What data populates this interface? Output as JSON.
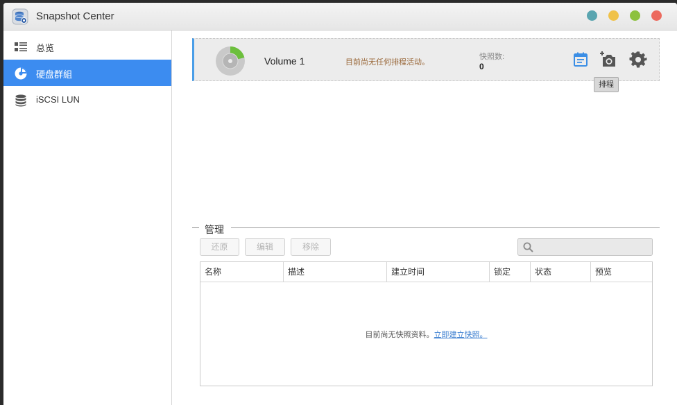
{
  "window": {
    "title": "Snapshot Center",
    "controls": [
      {
        "name": "minimize",
        "color": "#5aa5b0"
      },
      {
        "name": "maximize",
        "color": "#f0c24a"
      },
      {
        "name": "restore",
        "color": "#8dc13f"
      },
      {
        "name": "close",
        "color": "#ec6a5e"
      }
    ]
  },
  "sidebar": {
    "items": [
      {
        "label": "总览",
        "icon": "overview-list-icon",
        "active": false
      },
      {
        "label": "硬盘群組",
        "icon": "disk-group-icon",
        "active": true
      },
      {
        "label": "iSCSI LUN",
        "icon": "database-icon",
        "active": false
      }
    ]
  },
  "volume": {
    "name": "Volume 1",
    "status": "目前尚无任何排程活动。",
    "count_label": "快照数:",
    "count": "0",
    "accent": "#4a9ee8",
    "usage_color": "#6cbf3c",
    "actions": [
      {
        "icon": "schedule-calendar-icon",
        "color": "#3b8ee5"
      },
      {
        "icon": "add-snapshot-camera-icon",
        "color": "#555555"
      },
      {
        "icon": "settings-gear-icon",
        "color": "#555555"
      }
    ],
    "tooltip": "排程"
  },
  "manage": {
    "title": "管理",
    "buttons": [
      {
        "label": "还原"
      },
      {
        "label": "编辑"
      },
      {
        "label": "移除"
      }
    ],
    "search": {
      "placeholder": "",
      "value": ""
    },
    "columns": [
      "名称",
      "描述",
      "建立时间",
      "锁定",
      "状态",
      "预览"
    ],
    "empty_message": "目前尚无快照资料。",
    "empty_link": "立即建立快照。"
  }
}
